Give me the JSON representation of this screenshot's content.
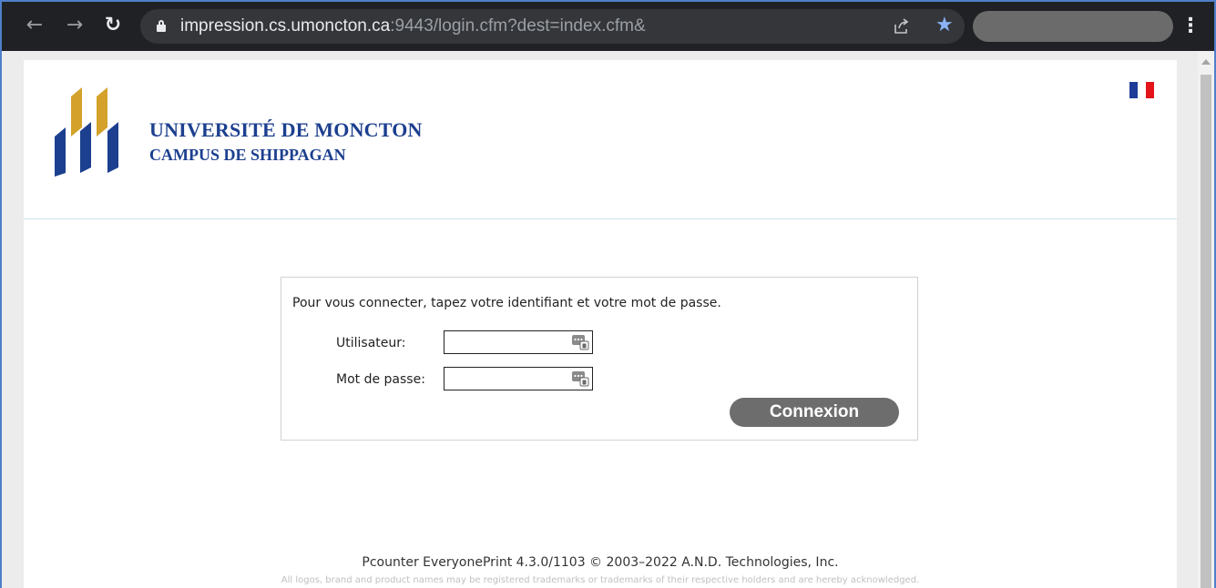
{
  "browser": {
    "url_host": "impression.cs.umoncton.ca",
    "url_path": ":9443/login.cfm?dest=index.cfm&",
    "icons": {
      "back": "back-arrow-icon",
      "forward": "forward-arrow-icon",
      "reload": "reload-icon",
      "lock": "lock-icon",
      "share": "share-icon",
      "bookmark": "star-icon",
      "menu": "kebab-menu-icon"
    }
  },
  "header": {
    "university": "UNIVERSITÉ DE MONCTON",
    "campus": "CAMPUS DE SHIPPAGAN",
    "language_flag": "flag-france-icon"
  },
  "login": {
    "instruction": "Pour vous connecter, tapez votre identifiant et votre mot de passe.",
    "username_label": "Utilisateur:",
    "username_value": "",
    "password_label": "Mot de passe:",
    "password_value": "",
    "submit_label": "Connexion"
  },
  "footer": {
    "product": "Pcounter EveryonePrint 4.3.0/1103 © 2003–2022 A.N.D. Technologies, Inc.",
    "trademarks": "All logos, brand and product names may be registered trademarks or trademarks of their respective holders and are hereby acknowledged."
  },
  "colors": {
    "brand_blue": "#1c3f8f",
    "brand_gold": "#d4a22a",
    "toolbar": "#202124",
    "button": "#6d6d6d"
  }
}
